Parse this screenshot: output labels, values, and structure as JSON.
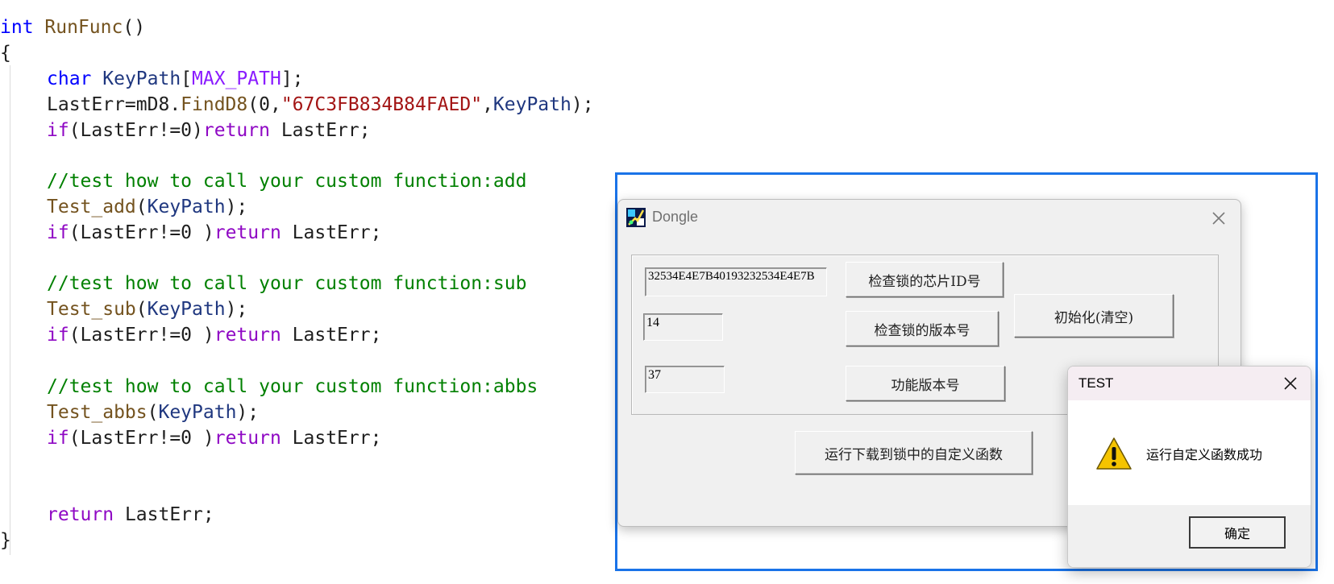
{
  "code": {
    "line1": {
      "kw": "int",
      "fn": "RunFunc",
      "rest": "()"
    },
    "line2": "{",
    "line3": {
      "kw": "char",
      "id": "KeyPath",
      "open": "[",
      "macro": "MAX_PATH",
      "close": "];"
    },
    "line4": {
      "a": "LastErr=mD8.",
      "fn": "FindD8",
      "b": "(0,",
      "str": "\"67C3FB834B84FAED\"",
      "c": ",",
      "id": "KeyPath",
      "d": ");"
    },
    "line5": {
      "kw": "if",
      "a": "(LastErr!=0)",
      "kw2": "return",
      "b": " LastErr;"
    },
    "line6": {
      "comment": "//test how to call your custom function:add"
    },
    "line7": {
      "fn": "Test_add",
      "a": "(",
      "id": "KeyPath",
      "b": ");"
    },
    "line8": {
      "kw": "if",
      "a": "(LastErr!=0 )",
      "kw2": "return",
      "b": " LastErr;"
    },
    "line9": {
      "comment": "//test how to call your custom function:sub"
    },
    "line10": {
      "fn": "Test_sub",
      "a": "(",
      "id": "KeyPath",
      "b": ");"
    },
    "line11": {
      "kw": "if",
      "a": "(LastErr!=0 )",
      "kw2": "return",
      "b": " LastErr;"
    },
    "line12": {
      "comment": "//test how to call your custom function:abbs"
    },
    "line13": {
      "fn": "Test_abbs",
      "a": "(",
      "id": "KeyPath",
      "b": ");"
    },
    "line14": {
      "kw": "if",
      "a": "(LastErr!=0 )",
      "kw2": "return",
      "b": " LastErr;"
    },
    "line15": {
      "kw": "return",
      "b": " LastErr;"
    },
    "line16": "}"
  },
  "dongle": {
    "title": "Dongle",
    "chip_id_value": "32534E4E7B40193232534E4E7B",
    "version_value": "14",
    "func_version_value": "37",
    "btn_check_chip_id": "检查锁的芯片ID号",
    "btn_check_version": "检查锁的版本号",
    "btn_func_version": "功能版本号",
    "btn_init": "初始化(清空)",
    "btn_run_custom": "运行下载到锁中的自定义函数"
  },
  "message_box": {
    "title": "TEST",
    "text": "运行自定义函数成功",
    "ok": "确定"
  },
  "colors": {
    "selection_frame": "#1a73e8",
    "keyword": "#0000ff",
    "control_keyword": "#8f08c4",
    "function": "#74531f",
    "identifier": "#1f377f",
    "string": "#a31515",
    "comment": "#008000"
  }
}
